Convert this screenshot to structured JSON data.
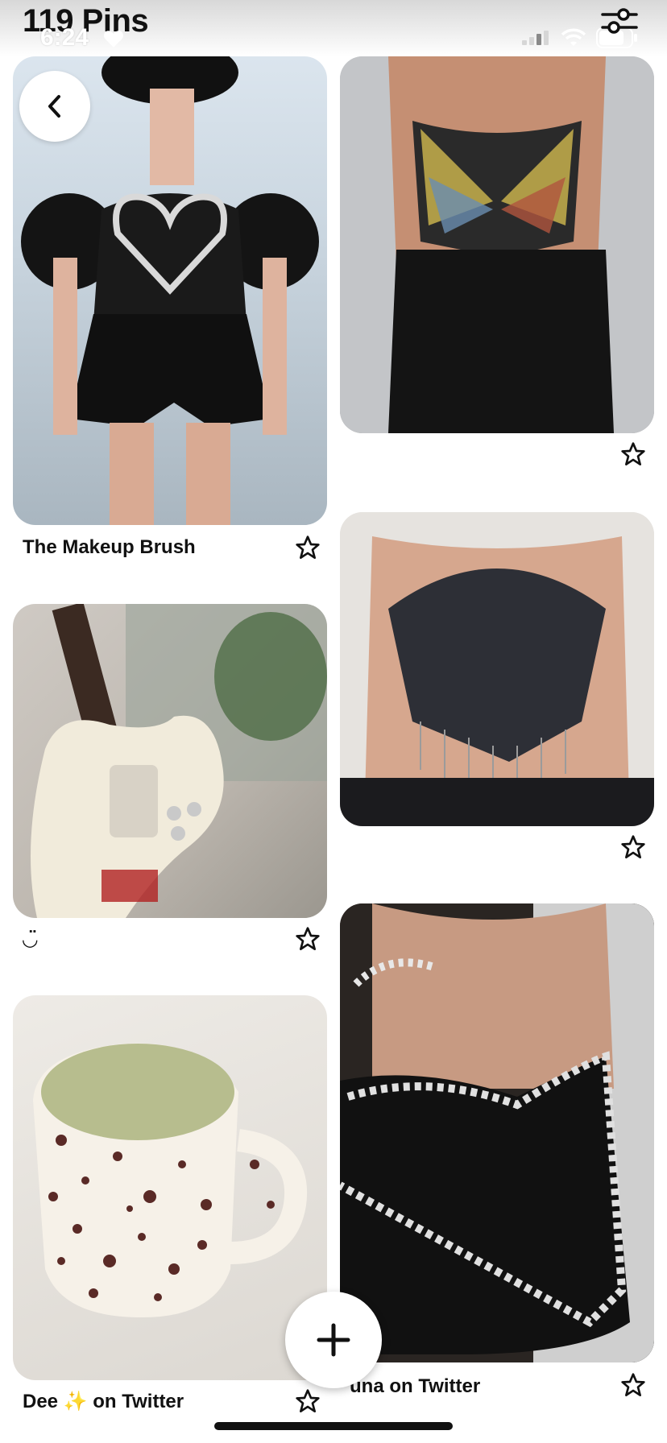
{
  "header": {
    "title": "119 Pins",
    "time": "6:24"
  },
  "pins": [
    {
      "id": "pin-1",
      "caption": "The Makeup Brush",
      "icon": "runway-heart-romper"
    },
    {
      "id": "pin-2",
      "caption": "",
      "icon": "butterfly-sequin-top"
    },
    {
      "id": "pin-3",
      "caption": "",
      "icon": "halter-beaded-top"
    },
    {
      "id": "pin-4",
      "caption": "◡̈",
      "icon": "sticker-guitar"
    },
    {
      "id": "pin-5",
      "caption": "Dee ✨ on Twitter",
      "icon": "speckled-mug-matcha"
    },
    {
      "id": "pin-6",
      "caption": "una on Twitter",
      "icon": "rhinestone-heart-top"
    }
  ],
  "colors": {
    "text": "#111111",
    "background": "#ffffff"
  }
}
